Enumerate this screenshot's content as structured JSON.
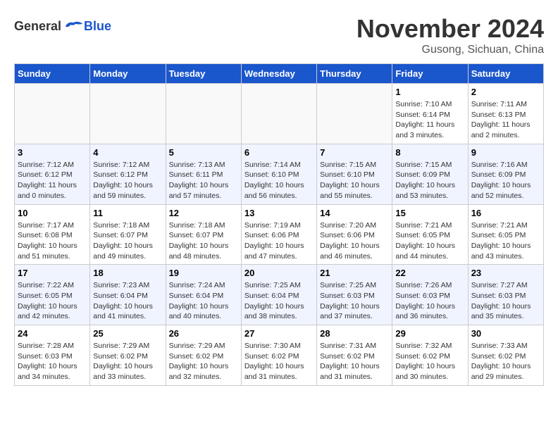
{
  "header": {
    "logo_general": "General",
    "logo_blue": "Blue",
    "title": "November 2024",
    "subtitle": "Gusong, Sichuan, China"
  },
  "weekdays": [
    "Sunday",
    "Monday",
    "Tuesday",
    "Wednesday",
    "Thursday",
    "Friday",
    "Saturday"
  ],
  "weeks": [
    [
      {
        "day": "",
        "info": ""
      },
      {
        "day": "",
        "info": ""
      },
      {
        "day": "",
        "info": ""
      },
      {
        "day": "",
        "info": ""
      },
      {
        "day": "",
        "info": ""
      },
      {
        "day": "1",
        "info": "Sunrise: 7:10 AM\nSunset: 6:14 PM\nDaylight: 11 hours and 3 minutes."
      },
      {
        "day": "2",
        "info": "Sunrise: 7:11 AM\nSunset: 6:13 PM\nDaylight: 11 hours and 2 minutes."
      }
    ],
    [
      {
        "day": "3",
        "info": "Sunrise: 7:12 AM\nSunset: 6:12 PM\nDaylight: 11 hours and 0 minutes."
      },
      {
        "day": "4",
        "info": "Sunrise: 7:12 AM\nSunset: 6:12 PM\nDaylight: 10 hours and 59 minutes."
      },
      {
        "day": "5",
        "info": "Sunrise: 7:13 AM\nSunset: 6:11 PM\nDaylight: 10 hours and 57 minutes."
      },
      {
        "day": "6",
        "info": "Sunrise: 7:14 AM\nSunset: 6:10 PM\nDaylight: 10 hours and 56 minutes."
      },
      {
        "day": "7",
        "info": "Sunrise: 7:15 AM\nSunset: 6:10 PM\nDaylight: 10 hours and 55 minutes."
      },
      {
        "day": "8",
        "info": "Sunrise: 7:15 AM\nSunset: 6:09 PM\nDaylight: 10 hours and 53 minutes."
      },
      {
        "day": "9",
        "info": "Sunrise: 7:16 AM\nSunset: 6:09 PM\nDaylight: 10 hours and 52 minutes."
      }
    ],
    [
      {
        "day": "10",
        "info": "Sunrise: 7:17 AM\nSunset: 6:08 PM\nDaylight: 10 hours and 51 minutes."
      },
      {
        "day": "11",
        "info": "Sunrise: 7:18 AM\nSunset: 6:07 PM\nDaylight: 10 hours and 49 minutes."
      },
      {
        "day": "12",
        "info": "Sunrise: 7:18 AM\nSunset: 6:07 PM\nDaylight: 10 hours and 48 minutes."
      },
      {
        "day": "13",
        "info": "Sunrise: 7:19 AM\nSunset: 6:06 PM\nDaylight: 10 hours and 47 minutes."
      },
      {
        "day": "14",
        "info": "Sunrise: 7:20 AM\nSunset: 6:06 PM\nDaylight: 10 hours and 46 minutes."
      },
      {
        "day": "15",
        "info": "Sunrise: 7:21 AM\nSunset: 6:05 PM\nDaylight: 10 hours and 44 minutes."
      },
      {
        "day": "16",
        "info": "Sunrise: 7:21 AM\nSunset: 6:05 PM\nDaylight: 10 hours and 43 minutes."
      }
    ],
    [
      {
        "day": "17",
        "info": "Sunrise: 7:22 AM\nSunset: 6:05 PM\nDaylight: 10 hours and 42 minutes."
      },
      {
        "day": "18",
        "info": "Sunrise: 7:23 AM\nSunset: 6:04 PM\nDaylight: 10 hours and 41 minutes."
      },
      {
        "day": "19",
        "info": "Sunrise: 7:24 AM\nSunset: 6:04 PM\nDaylight: 10 hours and 40 minutes."
      },
      {
        "day": "20",
        "info": "Sunrise: 7:25 AM\nSunset: 6:04 PM\nDaylight: 10 hours and 38 minutes."
      },
      {
        "day": "21",
        "info": "Sunrise: 7:25 AM\nSunset: 6:03 PM\nDaylight: 10 hours and 37 minutes."
      },
      {
        "day": "22",
        "info": "Sunrise: 7:26 AM\nSunset: 6:03 PM\nDaylight: 10 hours and 36 minutes."
      },
      {
        "day": "23",
        "info": "Sunrise: 7:27 AM\nSunset: 6:03 PM\nDaylight: 10 hours and 35 minutes."
      }
    ],
    [
      {
        "day": "24",
        "info": "Sunrise: 7:28 AM\nSunset: 6:03 PM\nDaylight: 10 hours and 34 minutes."
      },
      {
        "day": "25",
        "info": "Sunrise: 7:29 AM\nSunset: 6:02 PM\nDaylight: 10 hours and 33 minutes."
      },
      {
        "day": "26",
        "info": "Sunrise: 7:29 AM\nSunset: 6:02 PM\nDaylight: 10 hours and 32 minutes."
      },
      {
        "day": "27",
        "info": "Sunrise: 7:30 AM\nSunset: 6:02 PM\nDaylight: 10 hours and 31 minutes."
      },
      {
        "day": "28",
        "info": "Sunrise: 7:31 AM\nSunset: 6:02 PM\nDaylight: 10 hours and 31 minutes."
      },
      {
        "day": "29",
        "info": "Sunrise: 7:32 AM\nSunset: 6:02 PM\nDaylight: 10 hours and 30 minutes."
      },
      {
        "day": "30",
        "info": "Sunrise: 7:33 AM\nSunset: 6:02 PM\nDaylight: 10 hours and 29 minutes."
      }
    ]
  ]
}
